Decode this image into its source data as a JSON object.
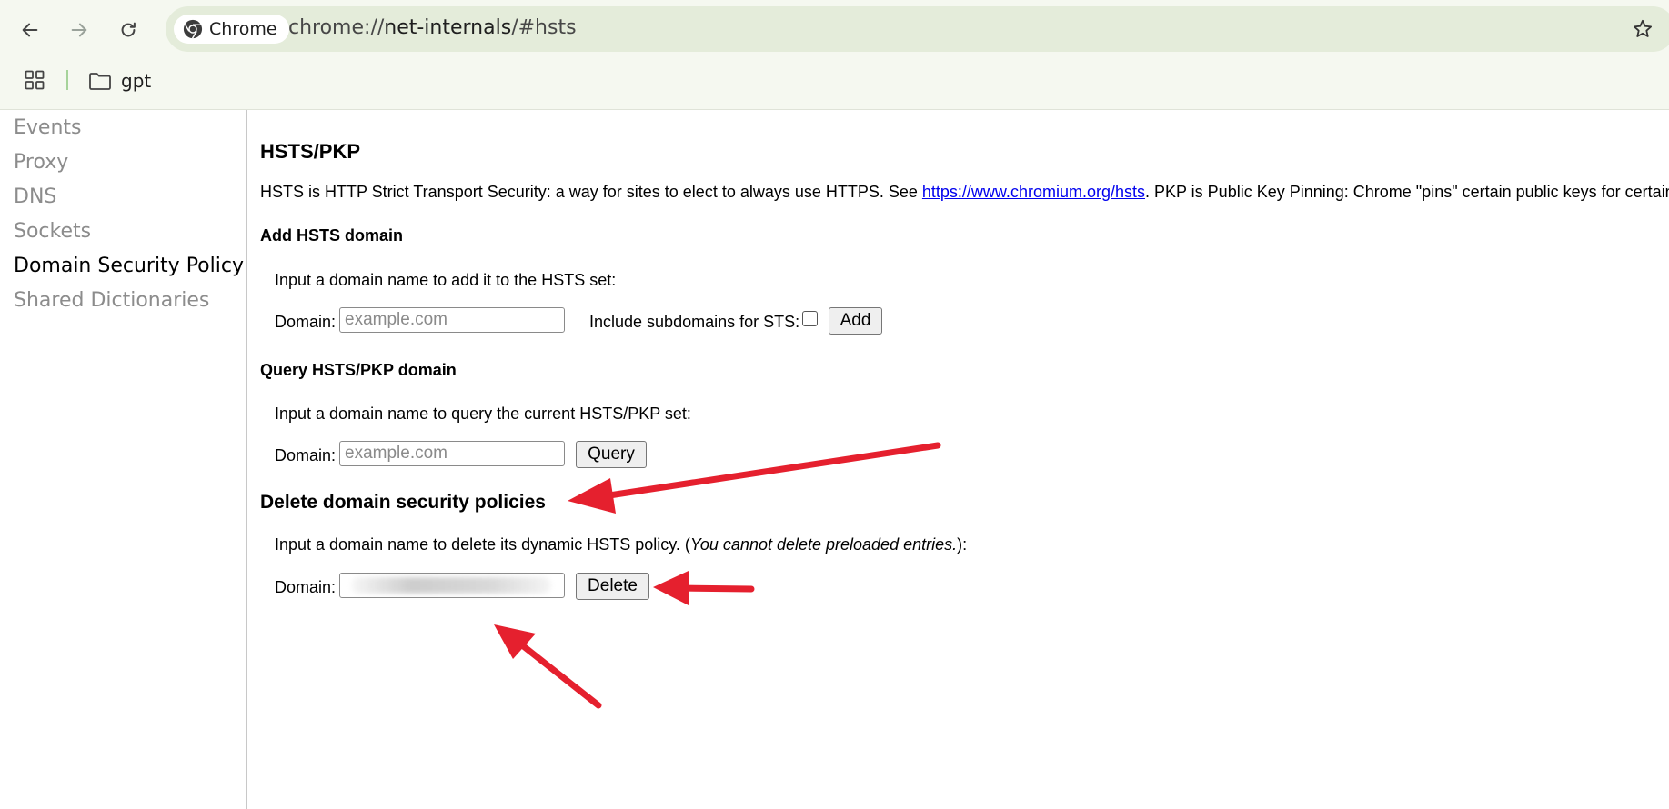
{
  "browser": {
    "chip_label": "Chrome",
    "url_prefix": "chrome://",
    "url_host": "net-internals",
    "url_suffix": "/#hsts",
    "bookmarks": [
      {
        "label": "gpt"
      }
    ]
  },
  "sidebar": {
    "items": [
      {
        "label": "Events"
      },
      {
        "label": "Proxy"
      },
      {
        "label": "DNS"
      },
      {
        "label": "Sockets"
      },
      {
        "label": "Domain Security Policy",
        "active": true
      },
      {
        "label": "Shared Dictionaries"
      }
    ]
  },
  "main": {
    "title": "HSTS/PKP",
    "description_before": "HSTS is HTTP Strict Transport Security: a way for sites to elect to always use HTTPS. See ",
    "description_link": "https://www.chromium.org/hsts",
    "description_after": ". PKP is Public Key Pinning: Chrome \"pins\" certain public keys for certain sites",
    "add": {
      "heading": "Add HSTS domain",
      "instruction": "Input a domain name to add it to the HSTS set:",
      "domain_label": "Domain:",
      "placeholder": "example.com",
      "include_subdomains_label": "Include subdomains for STS:",
      "button": "Add"
    },
    "query": {
      "heading": "Query HSTS/PKP domain",
      "instruction": "Input a domain name to query the current HSTS/PKP set:",
      "domain_label": "Domain:",
      "placeholder": "example.com",
      "button": "Query"
    },
    "delete": {
      "heading": "Delete domain security policies",
      "instruction_before": "Input a domain name to delete its dynamic HSTS policy. (",
      "instruction_italic": "You cannot delete preloaded entries.",
      "instruction_after": "):",
      "domain_label": "Domain:",
      "button": "Delete"
    }
  },
  "colors": {
    "toolbar_bg": "#f5f8f0",
    "omnibox_bg": "#e4ecda",
    "link": "#0000ee",
    "annotation_arrow": "#e5202e",
    "sidebar_inactive": "#8c8c8c"
  }
}
